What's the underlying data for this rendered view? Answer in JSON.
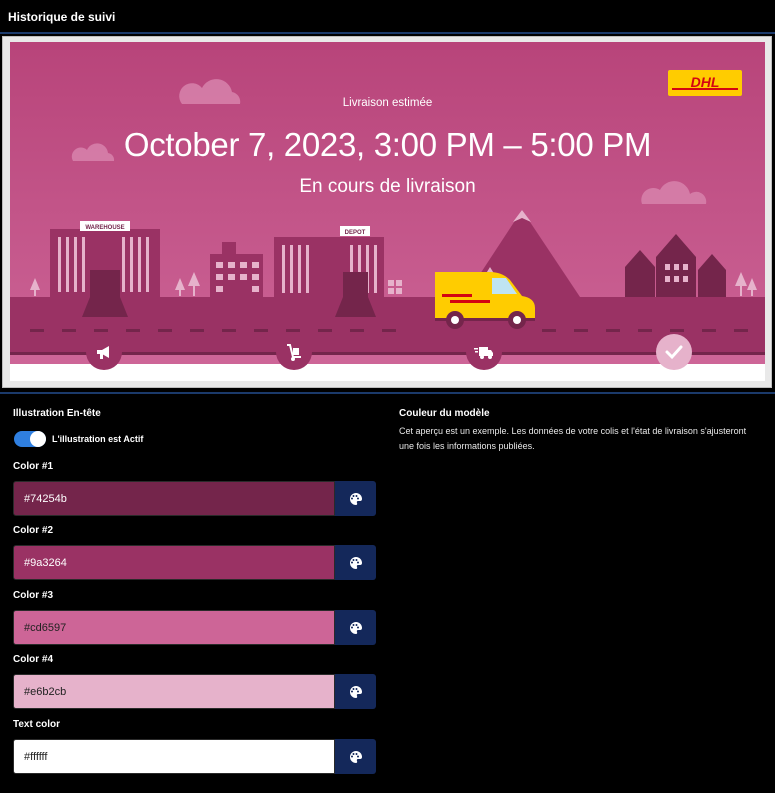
{
  "page": {
    "title": "Historique de suivi"
  },
  "preview": {
    "brand": "DHL",
    "eta_label": "Livraison estimée",
    "eta_date": "October 7, 2023, 3:00 PM – 5:00 PM",
    "status": "En cours de livraison",
    "warehouse_sign": "WAREHOUSE",
    "depot_sign": "DEPOT",
    "steps": [
      {
        "icon": "megaphone-icon"
      },
      {
        "icon": "hand-truck-icon"
      },
      {
        "icon": "delivery-truck-icon"
      },
      {
        "icon": "checkmark-icon"
      }
    ]
  },
  "illustration": {
    "title": "Illustration En-tête",
    "toggle_label": "L'illustration est Actif",
    "enabled": true
  },
  "colors": [
    {
      "label": "Color #1",
      "value": "#74254b"
    },
    {
      "label": "Color #2",
      "value": "#9a3264"
    },
    {
      "label": "Color #3",
      "value": "#cd6597"
    },
    {
      "label": "Color #4",
      "value": "#e6b2cb"
    },
    {
      "label": "Text color",
      "value": "#ffffff"
    }
  ],
  "template_color": {
    "title": "Couleur du modèle",
    "description": "Cet aperçu est un exemple. Les données de votre colis et l'état de livraison s'ajusteront une fois les informations publiées."
  },
  "theme": {
    "accent": "#2f7fe0",
    "picker_bg": "#14285a",
    "brand_yellow": "#ffcc00",
    "brand_red": "#d40511"
  }
}
